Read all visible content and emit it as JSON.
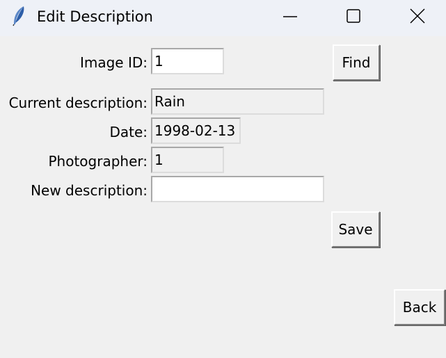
{
  "window": {
    "title": "Edit Description",
    "app_icon": "feather-icon",
    "controls": [
      "minimize-icon",
      "maximize-icon",
      "close-icon"
    ]
  },
  "form": {
    "image_id_label": "Image ID:",
    "image_id_value": "1",
    "find_button": "Find",
    "current_description_label": "Current description:",
    "current_description_value": "Rain",
    "date_label": "Date:",
    "date_value": "1998-02-13",
    "photographer_label": "Photographer:",
    "photographer_value": "1",
    "new_description_label": "New description:",
    "new_description_value": "",
    "save_button": "Save",
    "back_button": "Back"
  }
}
